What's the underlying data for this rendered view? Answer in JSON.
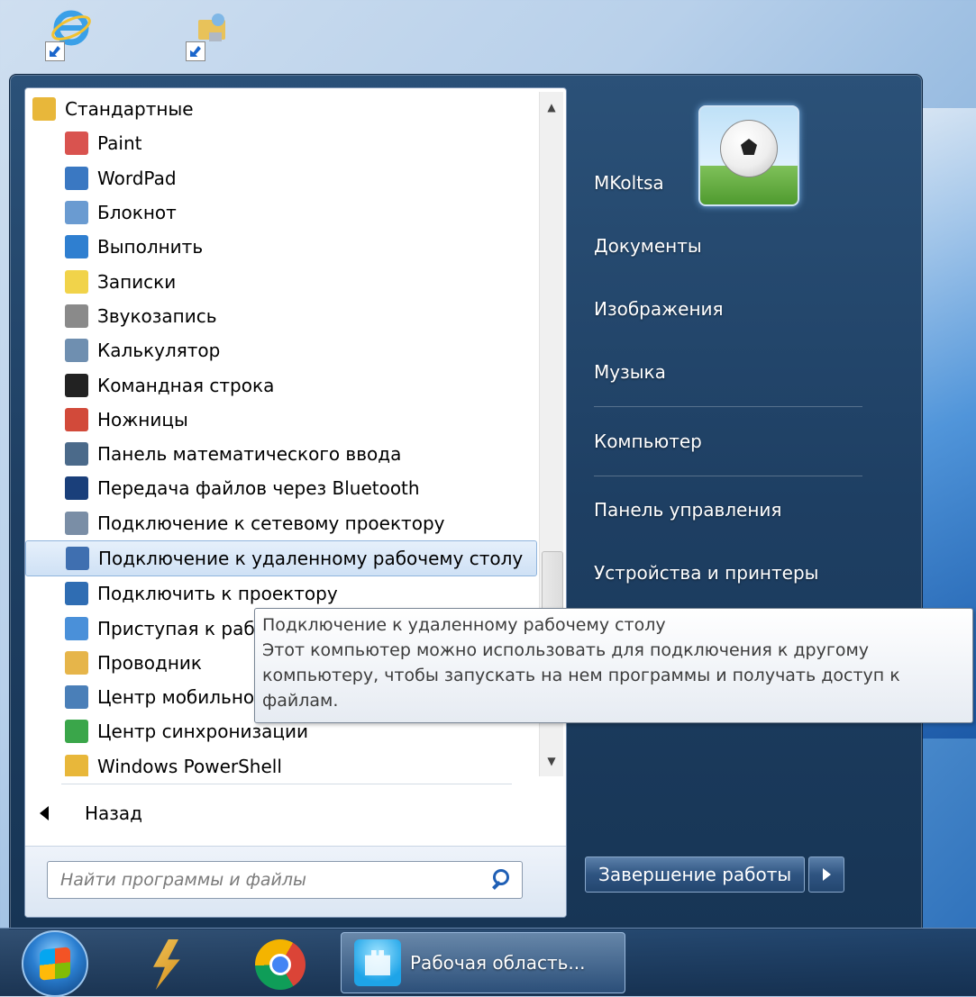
{
  "start_menu": {
    "programs": [
      {
        "label": "Стандартные",
        "icon": "folder-icon",
        "color": "#e8b73a"
      },
      {
        "label": "Paint",
        "icon": "paint-icon",
        "color": "#d9534f"
      },
      {
        "label": "WordPad",
        "icon": "wordpad-icon",
        "color": "#3a78c2"
      },
      {
        "label": "Блокнот",
        "icon": "notepad-icon",
        "color": "#6a9bd1"
      },
      {
        "label": "Выполнить",
        "icon": "run-icon",
        "color": "#2f7fd0"
      },
      {
        "label": "Записки",
        "icon": "sticky-notes-icon",
        "color": "#f1d34a"
      },
      {
        "label": "Звукозапись",
        "icon": "microphone-icon",
        "color": "#8a8a8a"
      },
      {
        "label": "Калькулятор",
        "icon": "calculator-icon",
        "color": "#6f8fb0"
      },
      {
        "label": "Командная строка",
        "icon": "command-prompt-icon",
        "color": "#222222"
      },
      {
        "label": "Ножницы",
        "icon": "scissors-icon",
        "color": "#d24a3a"
      },
      {
        "label": "Панель математического ввода",
        "icon": "math-input-icon",
        "color": "#4b6a8a"
      },
      {
        "label": "Передача файлов через Bluetooth",
        "icon": "bluetooth-icon",
        "color": "#1a3f7a"
      },
      {
        "label": "Подключение к сетевому проектору",
        "icon": "network-projector-icon",
        "color": "#7a8ea6"
      },
      {
        "label": "Подключение к удаленному рабочему столу",
        "icon": "remote-desktop-icon",
        "color": "#3f6fb0"
      },
      {
        "label": "Подключить к проектору",
        "icon": "projector-icon",
        "color": "#2f6db3"
      },
      {
        "label": "Приступая к работе",
        "icon": "getting-started-icon",
        "color": "#4a90d9"
      },
      {
        "label": "Проводник",
        "icon": "explorer-icon",
        "color": "#e6b54a"
      },
      {
        "label": "Центр мобильности Windows",
        "icon": "mobility-center-icon",
        "color": "#4a7fb8"
      },
      {
        "label": "Центр синхронизации",
        "icon": "sync-center-icon",
        "color": "#3aa64a"
      },
      {
        "label": "Windows PowerShell",
        "icon": "folder-icon",
        "color": "#e8b73a"
      }
    ],
    "selected_index": 13,
    "back_label": "Назад",
    "search_placeholder": "Найти программы и файлы",
    "user_name": "MKoltsa",
    "right_items": [
      "Документы",
      "Изображения",
      "Музыка",
      "Компьютер",
      "Панель управления",
      "Устройства и принтеры"
    ],
    "shutdown_label": "Завершение работы"
  },
  "tooltip": {
    "title": "Подключение к удаленному рабочему столу",
    "description": "Этот компьютер можно использовать для подключения к другому компьютеру, чтобы запускать на нем программы и получать доступ к файлам."
  },
  "taskbar": {
    "active_window_label": "Рабочая область..."
  },
  "colors": {
    "menu_bg": "#1e3f63",
    "selection_bg": "#cfe1f5",
    "tooltip_border": "#7a8796"
  }
}
